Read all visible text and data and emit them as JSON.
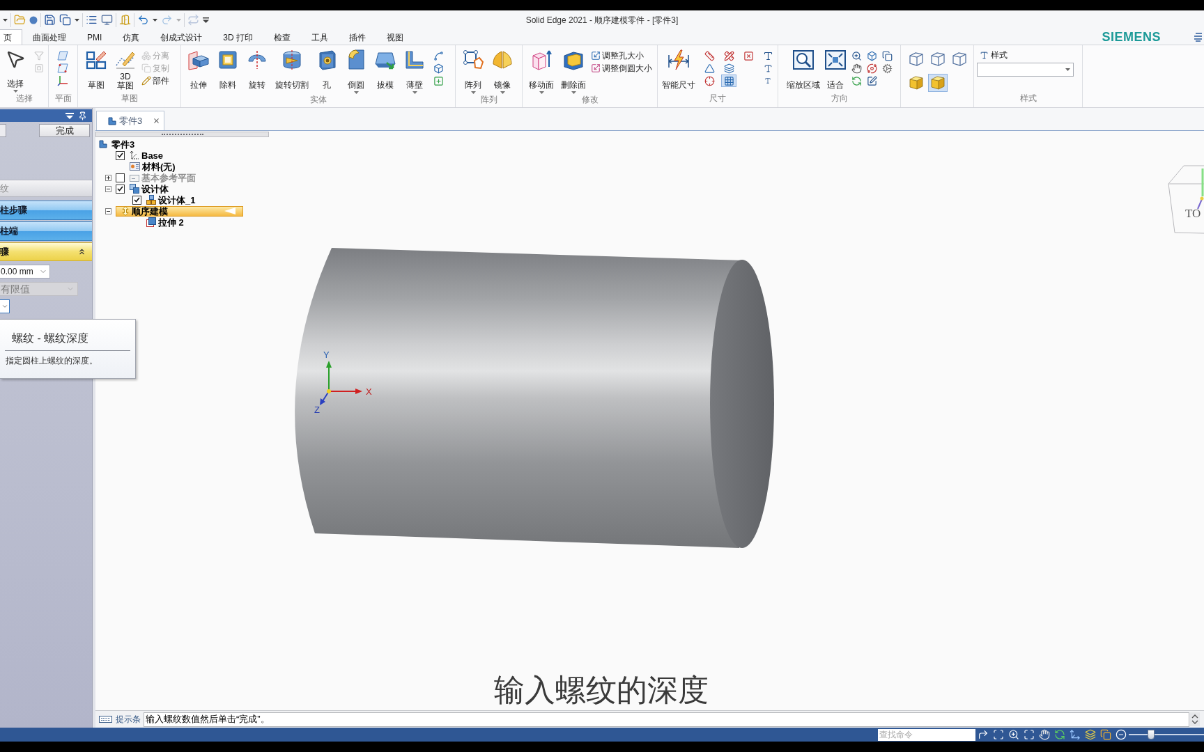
{
  "window": {
    "title": "Solid Edge 2021 - 顺序建模零件 - [零件3]",
    "brand": "SIEMENS"
  },
  "quick_access": [
    [
      {
        "kind": "caret",
        "disabled": false
      }
    ],
    [
      {
        "kind": "open",
        "disabled": false
      },
      {
        "kind": "sphere",
        "disabled": false
      }
    ],
    [
      {
        "kind": "save",
        "disabled": false
      },
      {
        "kind": "save_as",
        "disabled": false
      },
      {
        "kind": "caret",
        "disabled": false
      }
    ],
    [
      {
        "kind": "list",
        "disabled": false
      },
      {
        "kind": "screen",
        "disabled": false
      }
    ],
    [
      {
        "kind": "exit",
        "disabled": false
      }
    ],
    [
      {
        "kind": "undo",
        "disabled": false
      },
      {
        "kind": "caret",
        "disabled": false
      },
      {
        "kind": "redo",
        "disabled": true
      },
      {
        "kind": "caret",
        "disabled": true
      }
    ],
    [
      {
        "kind": "repeat",
        "disabled": true
      },
      {
        "kind": "customize",
        "disabled": false
      }
    ]
  ],
  "tabs": [
    {
      "label": "页",
      "selected": true
    },
    {
      "label": "曲面处理",
      "selected": false
    },
    {
      "label": "PMI",
      "selected": false
    },
    {
      "label": "仿真",
      "selected": false
    },
    {
      "label": "创成式设计",
      "selected": false
    },
    {
      "label": "3D 打印",
      "selected": false
    },
    {
      "label": "检查",
      "selected": false
    },
    {
      "label": "工具",
      "selected": false
    },
    {
      "label": "插件",
      "selected": false
    },
    {
      "label": "视图",
      "selected": false
    }
  ],
  "ribbon": [
    {
      "label": "选择",
      "items": [
        {
          "kind": "large",
          "label": "选择",
          "dropdown": true
        },
        {
          "kind": "stack",
          "items": [
            {
              "kind": "icon",
              "disabled": true
            },
            {
              "kind": "icon",
              "disabled": true
            }
          ]
        }
      ]
    },
    {
      "label": "平面",
      "items": [
        {
          "kind": "stack",
          "items": [
            {
              "kind": "icon",
              "disabled": false
            },
            {
              "kind": "icon",
              "disabled": false
            },
            {
              "kind": "icon",
              "disabled": false
            }
          ]
        }
      ]
    },
    {
      "label": "草图",
      "items": [
        {
          "kind": "large",
          "label": "草图",
          "dropdown": false
        },
        {
          "kind": "large",
          "label": "3D 草图",
          "dropdown": false
        },
        {
          "kind": "stack",
          "items": [
            {
              "kind": "small",
              "label": "分离",
              "disabled": true
            },
            {
              "kind": "small",
              "label": "复制",
              "disabled": true
            },
            {
              "kind": "small",
              "label": "部件",
              "disabled": false
            }
          ]
        }
      ]
    },
    {
      "label": "实体",
      "items": [
        {
          "kind": "large",
          "label": "拉伸",
          "dropdown": false
        },
        {
          "kind": "large",
          "label": "除料",
          "dropdown": false
        },
        {
          "kind": "large",
          "label": "旋转",
          "dropdown": false
        },
        {
          "kind": "large",
          "label": "旋转切割",
          "dropdown": false
        },
        {
          "kind": "large",
          "label": "孔",
          "dropdown": false
        },
        {
          "kind": "large",
          "label": "倒圆",
          "dropdown": true
        },
        {
          "kind": "large",
          "label": "拔模",
          "dropdown": false
        },
        {
          "kind": "large",
          "label": "薄壁",
          "dropdown": true
        },
        {
          "kind": "stack",
          "items": [
            {
              "kind": "icon",
              "disabled": false
            },
            {
              "kind": "icon",
              "disabled": false
            },
            {
              "kind": "icon",
              "disabled": false
            }
          ]
        }
      ]
    },
    {
      "label": "阵列",
      "items": [
        {
          "kind": "large",
          "label": "阵列",
          "dropdown": true
        },
        {
          "kind": "large",
          "label": "镜像",
          "dropdown": true
        }
      ]
    },
    {
      "label": "修改",
      "items": [
        {
          "kind": "large",
          "label": "移动面",
          "dropdown": true
        },
        {
          "kind": "large",
          "label": "删除面",
          "dropdown": true
        },
        {
          "kind": "stack",
          "items": [
            {
              "kind": "small",
              "label": "调整孔大小",
              "disabled": false
            },
            {
              "kind": "small",
              "label": "调整倒圆大小",
              "disabled": false
            }
          ]
        }
      ]
    },
    {
      "label": "尺寸",
      "items": [
        {
          "kind": "large",
          "label": "智能尺寸",
          "dropdown": false
        },
        {
          "kind": "stack",
          "items": [
            {
              "kind": "icon",
              "on": false
            },
            {
              "kind": "icon",
              "on": false
            },
            {
              "kind": "icon",
              "on": false
            }
          ]
        },
        {
          "kind": "stack",
          "items": [
            {
              "kind": "icon",
              "on": false
            },
            {
              "kind": "icon",
              "on": false
            },
            {
              "kind": "icon",
              "on": true
            }
          ]
        },
        {
          "kind": "stack",
          "items": [
            {
              "kind": "icon",
              "on": false
            }
          ]
        },
        {
          "kind": "stack",
          "items": [
            {
              "kind": "icon",
              "on": false
            },
            {
              "kind": "icon",
              "on": false
            },
            {
              "kind": "icon",
              "on": false
            }
          ]
        }
      ]
    },
    {
      "label": "方向",
      "items": [
        {
          "kind": "large",
          "label": "缩放区域",
          "dropdown": false
        },
        {
          "kind": "large",
          "label": "适合",
          "dropdown": false
        },
        {
          "kind": "stack",
          "items": [
            {
              "kind": "icon",
              "disabled": false
            },
            {
              "kind": "icon",
              "disabled": false
            },
            {
              "kind": "icon",
              "disabled": false
            }
          ]
        },
        {
          "kind": "stack",
          "items": [
            {
              "kind": "icon",
              "disabled": false
            },
            {
              "kind": "icon",
              "disabled": false
            },
            {
              "kind": "icon",
              "disabled": false
            }
          ]
        },
        {
          "kind": "stack",
          "items": [
            {
              "kind": "icon",
              "disabled": false
            },
            {
              "kind": "icon",
              "disabled": false
            }
          ]
        }
      ]
    },
    {
      "items": [
        {
          "kind": "grid",
          "items": [
            {
              "kind": "icon",
              "selected": false
            },
            {
              "kind": "icon",
              "selected": false
            },
            {
              "kind": "icon",
              "selected": false
            },
            {
              "kind": "icon",
              "selected": false
            },
            {
              "kind": "icon",
              "selected": true
            }
          ]
        }
      ]
    },
    {
      "label": "样式",
      "items": [
        {
          "kind": "style_picker",
          "label": "样式"
        }
      ]
    }
  ],
  "left_panel": {
    "done": "完成",
    "sections": [
      {
        "kind": "header",
        "label": "纹"
      },
      {
        "kind": "step",
        "label": "柱步骤"
      },
      {
        "kind": "step",
        "label": "柱端"
      },
      {
        "kind": "current",
        "label": "骤",
        "expanded": true
      }
    ],
    "depth": {
      "value": "0.00 mm"
    },
    "extent": {
      "value": "有限值",
      "disabled": true
    }
  },
  "tooltip": {
    "title": "螺纹 - 螺纹深度",
    "body": "指定圆柱上螺纹的深度。"
  },
  "document_tab": {
    "label": "零件3"
  },
  "tree": [
    {
      "kind": "part",
      "label": "零件3",
      "selected": false,
      "children": [
        {
          "kind": "coord",
          "label": "Base",
          "checked": true,
          "selected": false
        },
        {
          "kind": "material",
          "label": "材料(无)",
          "selected": false
        },
        {
          "kind": "planes",
          "label": "基本参考平面",
          "checked": false,
          "expanded": false,
          "selected": false
        },
        {
          "kind": "bodies",
          "label": "设计体",
          "checked": true,
          "expanded": true,
          "selected": false,
          "children": [
            {
              "kind": "body",
              "label": "设计体_1",
              "checked": true,
              "selected": false
            }
          ]
        },
        {
          "kind": "sequence",
          "label": "顺序建模",
          "expanded": true,
          "selected": true,
          "children": [
            {
              "kind": "feature",
              "label": "拉伸 2",
              "selected": false
            }
          ]
        }
      ]
    }
  ],
  "viewport": {
    "triad": {
      "x": "X",
      "y": "Y",
      "z": "Z"
    },
    "view_cube": {
      "label": "TO"
    },
    "subtitle": "输入螺纹的深度"
  },
  "prompt_bar": {
    "label": "提示条",
    "message": "输入螺纹数值然后单击“完成”。"
  },
  "status_bar": {
    "search": {
      "placeholder": "查找命令"
    },
    "zoom": {
      "level": 0.3
    }
  }
}
